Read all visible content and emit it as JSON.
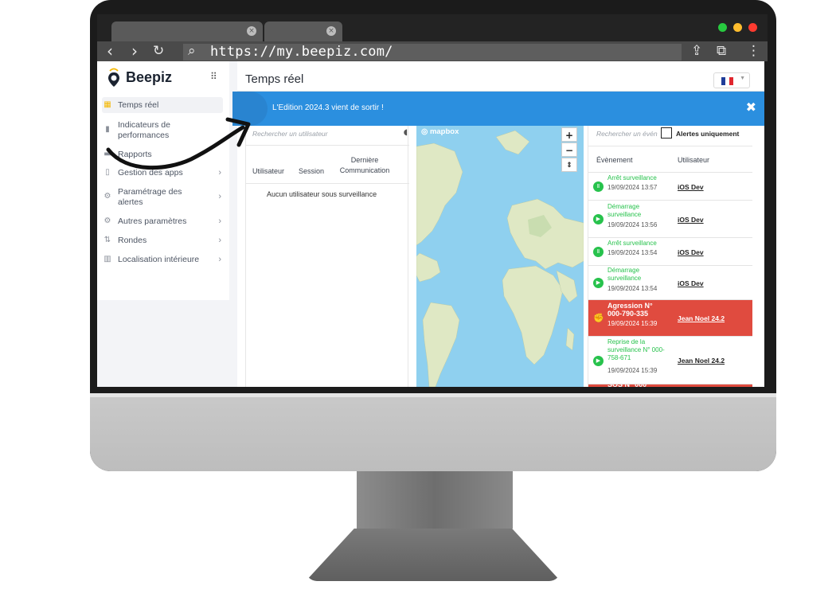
{
  "browser": {
    "url": "https://my.beepiz.com/",
    "tab_close_glyph": "×",
    "nav_back": "‹",
    "nav_forward": "›",
    "nav_reload": "↻",
    "search_glyph": "⌕",
    "share_glyph": "⇪",
    "window_glyph": "⧉",
    "menu_glyph": "⋮",
    "window_dots": [
      "#27c93f",
      "#ffbd2e",
      "#ff3b30"
    ]
  },
  "app": {
    "logo_text": "Beepiz",
    "page_title": "Temps réel",
    "language_flag": "fr"
  },
  "sidebar": {
    "items": [
      {
        "label": "Temps réel",
        "icon": "dashboard-icon",
        "glyph": "▦",
        "active": true,
        "chevron": false
      },
      {
        "label": "Indicateurs de performances",
        "icon": "chart-icon",
        "glyph": "▮",
        "active": false,
        "chevron": false
      },
      {
        "label": "Rapports",
        "icon": "report-icon",
        "glyph": "▬",
        "active": false,
        "chevron": false
      },
      {
        "label": "Gestion des apps",
        "icon": "phone-icon",
        "glyph": "▯",
        "active": false,
        "chevron": true
      },
      {
        "label": "Paramétrage des alertes",
        "icon": "alert-settings-icon",
        "glyph": "⚙",
        "active": false,
        "chevron": true
      },
      {
        "label": "Autres paramètres",
        "icon": "gear-icon",
        "glyph": "⚙",
        "active": false,
        "chevron": true
      },
      {
        "label": "Rondes",
        "icon": "rounds-icon",
        "glyph": "⇅",
        "active": false,
        "chevron": true
      },
      {
        "label": "Localisation intérieure",
        "icon": "building-icon",
        "glyph": "▥",
        "active": false,
        "chevron": true
      }
    ],
    "chevron_glyph": "›"
  },
  "banner": {
    "text": "L'Edition 2024.3 vient de sortir !",
    "close_glyph": "✖"
  },
  "users_panel": {
    "search_placeholder": "Rechercher un utilisateur",
    "columns": [
      "Utilisateur",
      "Session",
      "Dernière Communication"
    ],
    "empty_text": "Aucun utilisateur sous surveillance"
  },
  "map": {
    "provider": "mapbox",
    "zoom_in": "+",
    "zoom_out": "−",
    "compass": "⇕"
  },
  "events_panel": {
    "search_placeholder": "Rechercher un évén",
    "alerts_only_label": "Alertes uniquement",
    "columns": [
      "Évènement",
      "Utilisateur"
    ],
    "rows": [
      {
        "type": "Arrêt surveillance",
        "date": "19/09/2024 13:57",
        "user": "iOS Dev",
        "kind": "green",
        "icon": "pause-icon",
        "glyph": "Ⅱ"
      },
      {
        "type": "Démarrage surveillance",
        "date": "19/09/2024 13:56",
        "user": "iOS Dev",
        "kind": "green",
        "icon": "play-icon",
        "glyph": "▶"
      },
      {
        "type": "Arrêt surveillance",
        "date": "19/09/2024 13:54",
        "user": "iOS Dev",
        "kind": "green",
        "icon": "pause-icon",
        "glyph": "Ⅱ"
      },
      {
        "type": "Démarrage surveillance",
        "date": "19/09/2024 13:54",
        "user": "iOS Dev",
        "kind": "green",
        "icon": "play-icon",
        "glyph": "▶"
      },
      {
        "type": "Agression N° 000-790-335",
        "date": "19/09/2024 15:39",
        "user": "Jean Noel 24.2",
        "kind": "red",
        "icon": "fist-icon",
        "glyph": "✊"
      },
      {
        "type": "Reprise de la surveillance N° 000-758-671",
        "date": "19/09/2024 15:39",
        "user": "Jean Noel 24.2",
        "kind": "green",
        "icon": "play-icon",
        "glyph": "▶"
      },
      {
        "type": "SOS N° 000",
        "date": "",
        "user": "",
        "kind": "red",
        "icon": "sos-icon",
        "glyph": ""
      }
    ]
  }
}
